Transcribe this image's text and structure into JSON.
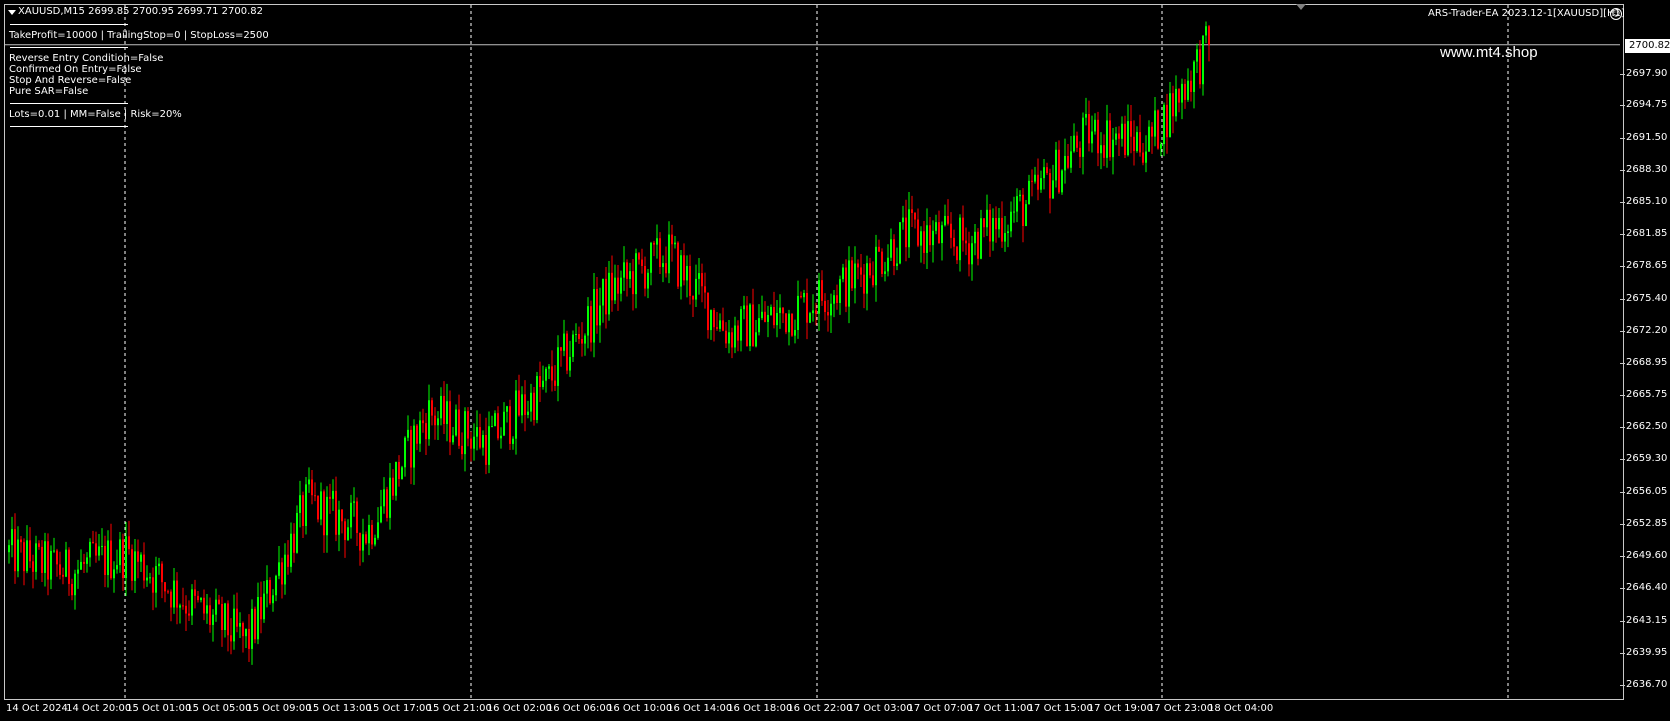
{
  "header": {
    "symbol_line": "XAUUSD,M15  2699.85 2700.95 2699.71 2700.82",
    "ea_title": "ARS-Trader-EA 2023.12-1[XAUUSD][H1]",
    "smiley": "☺"
  },
  "watermark": "www.mt4.shop",
  "info_panel": {
    "line1": "TakeProfit=10000 | TrailingStop=0 | StopLoss=2500",
    "line2": "Reverse Entry Condition=False",
    "line3": "Confirmed On Entry=False",
    "line4": "Stop And Reverse=False",
    "line5": "Pure SAR=False",
    "line6": "Lots=0.01 | MM=False | Risk=20%"
  },
  "current_price": "2700.82",
  "price_axis": [
    "2697.90",
    "2694.75",
    "2691.50",
    "2688.30",
    "2685.10",
    "2681.85",
    "2678.65",
    "2675.40",
    "2672.20",
    "2668.95",
    "2665.75",
    "2662.50",
    "2659.30",
    "2656.05",
    "2652.85",
    "2649.60",
    "2646.40",
    "2643.15",
    "2639.95",
    "2636.70"
  ],
  "time_axis": [
    "14 Oct 2024",
    "14 Oct 20:00",
    "15 Oct 01:00",
    "15 Oct 05:00",
    "15 Oct 09:00",
    "15 Oct 13:00",
    "15 Oct 17:00",
    "15 Oct 21:00",
    "16 Oct 02:00",
    "16 Oct 06:00",
    "16 Oct 10:00",
    "16 Oct 14:00",
    "16 Oct 18:00",
    "16 Oct 22:00",
    "17 Oct 03:00",
    "17 Oct 07:00",
    "17 Oct 11:00",
    "17 Oct 15:00",
    "17 Oct 19:00",
    "17 Oct 23:00",
    "18 Oct 04:00"
  ],
  "colors": {
    "bull": "#00ff00",
    "bear": "#ff0000",
    "background": "#000000",
    "grid": "#ffffff"
  },
  "chart_data": {
    "type": "candlestick",
    "symbol": "XAUUSD",
    "timeframe": "M15",
    "ylim": [
      2636.7,
      2701.5
    ],
    "anchor_prices": [
      [
        "14 Oct 2024",
        2650
      ],
      [
        "14 Oct 20:00",
        2648
      ],
      [
        "15 Oct 01:00",
        2650
      ],
      [
        "15 Oct 05:00",
        2645
      ],
      [
        "15 Oct 09:00",
        2641
      ],
      [
        "15 Oct 13:00",
        2655
      ],
      [
        "15 Oct 17:00",
        2652
      ],
      [
        "15 Oct 21:00",
        2664
      ],
      [
        "16 Oct 02:00",
        2661
      ],
      [
        "16 Oct 06:00",
        2667
      ],
      [
        "16 Oct 10:00",
        2676
      ],
      [
        "16 Oct 14:00",
        2680
      ],
      [
        "16 Oct 18:00",
        2672
      ],
      [
        "16 Oct 22:00",
        2674
      ],
      [
        "17 Oct 03:00",
        2677
      ],
      [
        "17 Oct 07:00",
        2682
      ],
      [
        "17 Oct 11:00",
        2681
      ],
      [
        "17 Oct 15:00",
        2685
      ],
      [
        "17 Oct 19:00",
        2692
      ],
      [
        "17 Oct 23:00",
        2691
      ],
      [
        "18 Oct 04:00",
        2700.82
      ]
    ]
  }
}
